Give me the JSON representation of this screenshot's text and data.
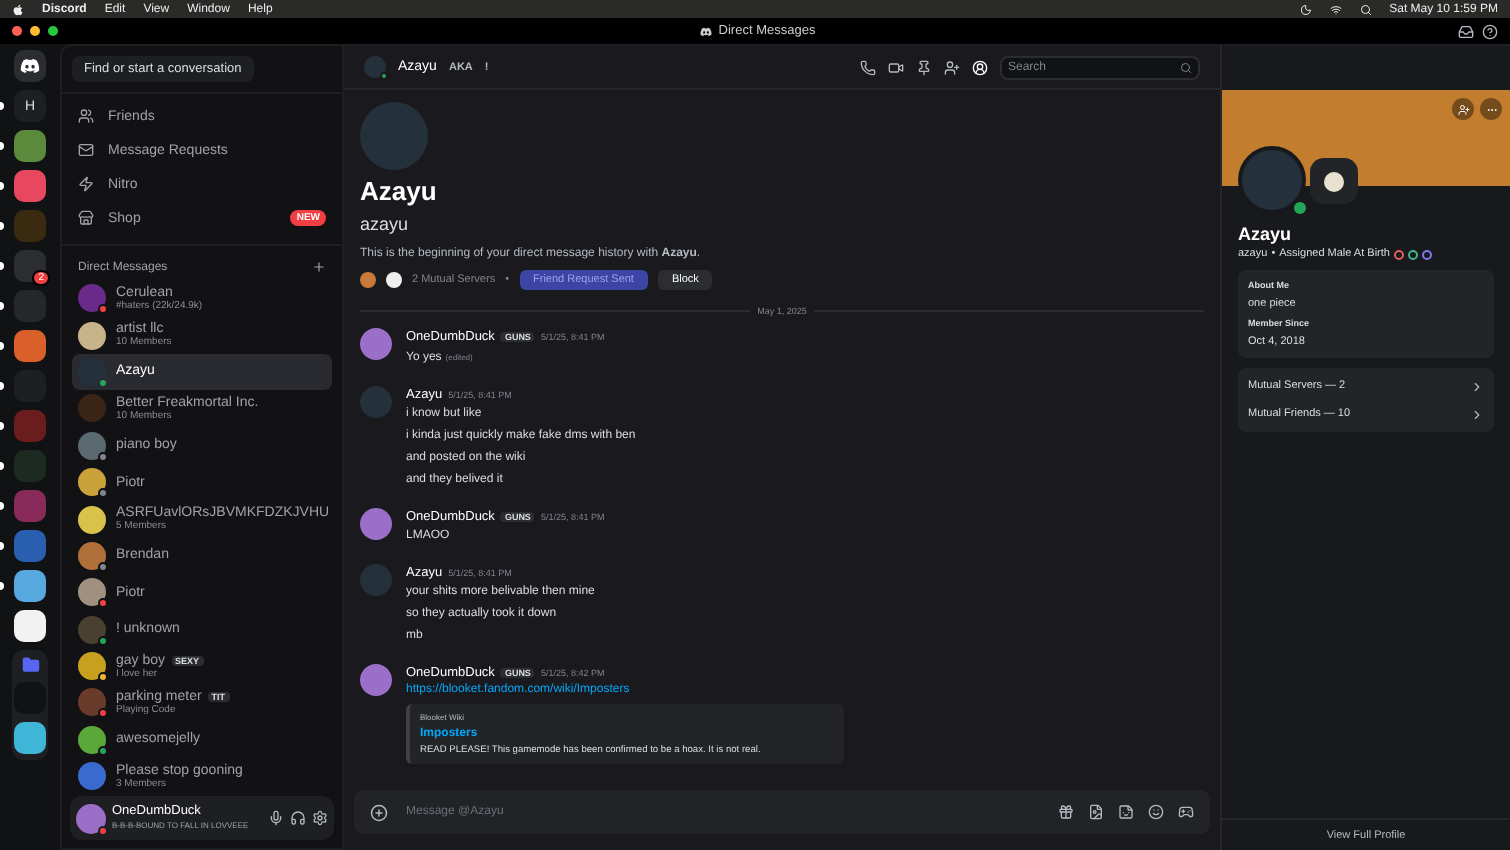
{
  "menubar": {
    "app": "Discord",
    "menus": [
      "Edit",
      "View",
      "Window",
      "Help"
    ],
    "clock": "Sat May 10  1:59 PM"
  },
  "titlebar": {
    "title": "Direct Messages"
  },
  "servers": [
    {
      "kind": "logo"
    },
    {
      "kind": "letter",
      "label": "H",
      "unread": true
    },
    {
      "kind": "image",
      "color": "#5b8a3c",
      "unread": true
    },
    {
      "kind": "image",
      "color": "#e8485f",
      "unread": true
    },
    {
      "kind": "image",
      "color": "#3a2a10",
      "unread": true
    },
    {
      "kind": "image",
      "color": "#2b2d31",
      "unread": true,
      "badge": "2"
    },
    {
      "kind": "image",
      "color": "#26272b",
      "unread": true
    },
    {
      "kind": "image",
      "color": "#d9602a",
      "unread": true
    },
    {
      "kind": "image",
      "color": "#1e1f22",
      "unread": true
    },
    {
      "kind": "image",
      "color": "#6b1c1c",
      "unread": true
    },
    {
      "kind": "image",
      "color": "#1d2a22",
      "unread": true
    },
    {
      "kind": "image",
      "color": "#8a2a5a",
      "unread": true
    },
    {
      "kind": "image",
      "color": "#2a5fb0",
      "unread": true
    },
    {
      "kind": "image",
      "color": "#58a8e0",
      "unread": true
    },
    {
      "kind": "image",
      "color": "#f2f2f2"
    },
    {
      "kind": "folder",
      "children": [
        {
          "kind": "image",
          "color": "#111214"
        },
        {
          "kind": "image",
          "color": "#3fb6d8"
        }
      ]
    }
  ],
  "search_button": {
    "label": "Find or start a conversation"
  },
  "nav": [
    {
      "kind": "friends",
      "label": "Friends"
    },
    {
      "kind": "requests",
      "label": "Message Requests"
    },
    {
      "kind": "nitro",
      "label": "Nitro"
    },
    {
      "kind": "shop",
      "label": "Shop",
      "badge": "NEW"
    }
  ],
  "dm_header": {
    "label": "Direct Messages"
  },
  "dms": [
    {
      "name": "Cerulean",
      "subtitle": "#haters (22k/24.9k)",
      "color": "#f23f43",
      "selected": false
    },
    {
      "name": "artist llc",
      "subtitle": "10 Members",
      "selected": false
    },
    {
      "name": "Azayu",
      "color": "#23a55a",
      "selected": true
    },
    {
      "name": "Better Freakmortal Inc.",
      "subtitle": "10 Members",
      "selected": false
    },
    {
      "name": "piano boy",
      "color": "#80848e",
      "selected": false
    },
    {
      "name": "Piotr",
      "color": "#80848e",
      "selected": false
    },
    {
      "name": "ASRFUavlORsJBVMKFDZKJVHU",
      "subtitle": "5 Members",
      "selected": false
    },
    {
      "name": "Brendan",
      "color": "#80848e",
      "selected": false
    },
    {
      "name": "Piotr",
      "color": "#f23f43",
      "selected": false
    },
    {
      "name": "! unknown",
      "color": "#23a55a",
      "selected": false
    },
    {
      "name": "gay boy",
      "tag": "SEXY",
      "subtitle": "I love her",
      "color": "#f0b232",
      "selected": false
    },
    {
      "name": "parking meter",
      "tag": "TIT",
      "subtitle": "Playing Code",
      "color": "#f23f43",
      "selected": false
    },
    {
      "name": "awesomejelly",
      "color": "#23a55a",
      "selected": false
    },
    {
      "name": "Please stop gooning",
      "subtitle": "3 Members",
      "selected": false
    }
  ],
  "user_panel": {
    "name": "OneDumbDuck",
    "status_text": "B-B-B-BOUND TO FALL IN LOVVEEE",
    "color": "#f23f43"
  },
  "chat_header": {
    "name": "Azayu",
    "color": "#23a55a",
    "aka": "AKA",
    "aka_count": "!",
    "search_placeholder": "Search"
  },
  "intro": {
    "display_name": "Azayu",
    "username": "azayu",
    "text": "This is the beginning of your direct message history with **Azayu**.",
    "mutual": "2 Mutual Servers",
    "separator": "•",
    "buttons": [
      {
        "kind": "primary",
        "label": "Friend Request Sent"
      },
      {
        "kind": "secondary",
        "label": "Block"
      }
    ]
  },
  "date_divider": "May 1, 2025",
  "messages": [
    {
      "author": "OneDumbDuck",
      "color": "#9b6fc8",
      "tag": "GUNS",
      "time": "5/1/25, 8:41 PM",
      "lines": [
        {
          "kind": "text",
          "text": "Yo yes",
          "edited": "(edited)"
        }
      ]
    },
    {
      "author": "Azayu",
      "color": "#24303a",
      "time": "5/1/25, 8:41 PM",
      "lines": [
        {
          "kind": "text",
          "text": "i know but like"
        },
        {
          "kind": "text",
          "text": "i kinda just quickly make fake dms with ben"
        },
        {
          "kind": "text",
          "text": "and posted on the wiki"
        },
        {
          "kind": "text",
          "text": "and they belived it"
        }
      ]
    },
    {
      "author": "OneDumbDuck",
      "color": "#9b6fc8",
      "tag": "GUNS",
      "time": "5/1/25, 8:41 PM",
      "lines": [
        {
          "kind": "text",
          "text": "LMAOO"
        }
      ]
    },
    {
      "author": "Azayu",
      "color": "#24303a",
      "time": "5/1/25, 8:41 PM",
      "lines": [
        {
          "kind": "text",
          "text": "your shits more belivable then mine"
        },
        {
          "kind": "text",
          "text": "so they actually took it down"
        },
        {
          "kind": "text",
          "text": "mb"
        }
      ]
    },
    {
      "author": "OneDumbDuck",
      "color": "#9b6fc8",
      "tag": "GUNS",
      "time": "5/1/25, 8:42 PM",
      "lines": [
        {
          "kind": "link",
          "text": "https://blooket.fandom.com/wiki/Imposters"
        }
      ],
      "embed": {
        "provider": "Blooket Wiki",
        "title": "Imposters",
        "description": "READ PLEASE! This gamemode has been confirmed to be a hoax. It is not real."
      }
    }
  ],
  "composer": {
    "placeholder": "Message @Azayu"
  },
  "profile": {
    "display_name": "Azayu",
    "username": "azayu",
    "separator": "•",
    "pronouns": "Assigned Male At Birth",
    "color": "#23a55a",
    "badges": [
      {
        "color": "#e0605a"
      },
      {
        "color": "#3fb58a"
      },
      {
        "color": "#7a7ae8"
      }
    ],
    "about_label": "About Me",
    "about": "one piece",
    "since_label": "Member Since",
    "since": "Oct 4, 2018",
    "links": [
      {
        "label": "Mutual Servers — 2"
      },
      {
        "label": "Mutual Friends — 10"
      }
    ],
    "footer": "View Full Profile"
  }
}
